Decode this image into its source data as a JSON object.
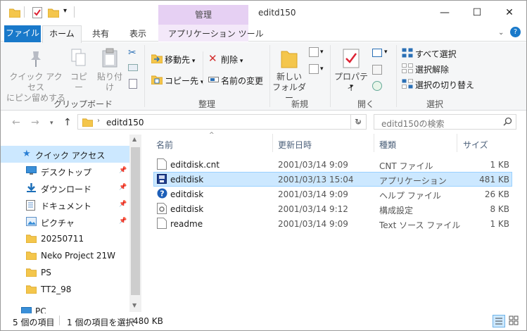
{
  "window": {
    "title": "editd150",
    "context_tab_group": "管理",
    "controls": [
      "—",
      "☐",
      "✕"
    ]
  },
  "ribbon_tabs": {
    "file": "ファイル",
    "home": "ホーム",
    "share": "共有",
    "view": "表示",
    "app_tools": "アプリケーション ツール"
  },
  "ribbon": {
    "clipboard": {
      "label": "クリップボード",
      "pin_line1": "クイック アクセス",
      "pin_line2": "にピン留めする",
      "copy": "コピー",
      "paste": "貼り付け"
    },
    "organize": {
      "label": "整理",
      "move_to": "移動先",
      "copy_to": "コピー先",
      "delete": "削除",
      "rename": "名前の変更"
    },
    "new": {
      "label": "新規",
      "new_folder_line1": "新しい",
      "new_folder_line2": "フォルダー"
    },
    "open": {
      "label": "開く",
      "properties": "プロパティ"
    },
    "select": {
      "label": "選択",
      "select_all": "すべて選択",
      "select_none": "選択解除",
      "invert": "選択の切り替え"
    }
  },
  "address": {
    "path": "editd150",
    "search_placeholder": "editd150の検索"
  },
  "nav": {
    "quick_access": "クイック アクセス",
    "items": [
      {
        "label": "デスクトップ",
        "icon": "desktop-icon",
        "pinned": true
      },
      {
        "label": "ダウンロード",
        "icon": "download-icon",
        "pinned": true
      },
      {
        "label": "ドキュメント",
        "icon": "document-icon",
        "pinned": true
      },
      {
        "label": "ピクチャ",
        "icon": "pictures-icon",
        "pinned": true
      },
      {
        "label": "20250711",
        "icon": "folder-icon",
        "pinned": false
      },
      {
        "label": "Neko Project 21W",
        "icon": "folder-icon",
        "pinned": false
      },
      {
        "label": "PS",
        "icon": "folder-icon",
        "pinned": false
      },
      {
        "label": "TT2_98",
        "icon": "folder-icon",
        "pinned": false
      }
    ],
    "pc": "PC"
  },
  "file_list": {
    "columns": {
      "name": "名前",
      "modified": "更新日時",
      "type": "種類",
      "size": "サイズ"
    },
    "rows": [
      {
        "name": "editdisk.cnt",
        "modified": "2001/03/14 9:09",
        "type": "CNT ファイル",
        "size": "1 KB",
        "icon": "text-file-icon"
      },
      {
        "name": "editdisk",
        "modified": "2001/03/13 15:04",
        "type": "アプリケーション",
        "size": "481 KB",
        "icon": "application-icon",
        "selected": true
      },
      {
        "name": "editdisk",
        "modified": "2001/03/14 9:09",
        "type": "ヘルプ ファイル",
        "size": "26 KB",
        "icon": "help-file-icon"
      },
      {
        "name": "editdisk",
        "modified": "2001/03/14 9:12",
        "type": "構成設定",
        "size": "8 KB",
        "icon": "settings-file-icon"
      },
      {
        "name": "readme",
        "modified": "2001/03/14 9:09",
        "type": "Text ソース ファイル",
        "size": "1 KB",
        "icon": "text-file-icon"
      }
    ]
  },
  "status": {
    "item_count": "5 個の項目",
    "selection": "1 個の項目を選択",
    "selection_size": "480 KB"
  },
  "colors": {
    "file_tab": "#1979ca",
    "context_tab": "#e6d0f3",
    "selection": "#cce8ff",
    "folder": "#f4c64c"
  }
}
